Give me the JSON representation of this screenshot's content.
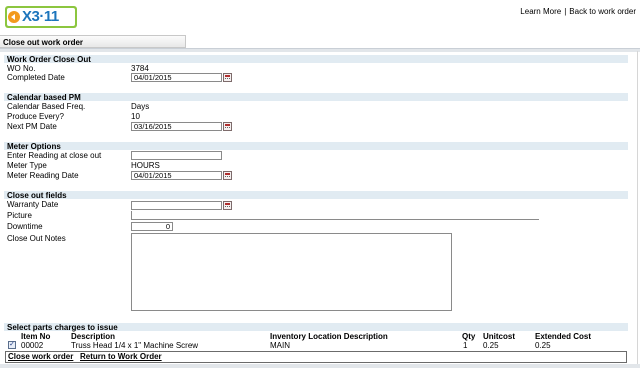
{
  "header": {
    "logo_text": "X3·11",
    "learn_more": "Learn More",
    "separator": "|",
    "back_link": "Back to work order"
  },
  "page_title": "Close out work order",
  "sections": {
    "close_out": {
      "title": "Work Order Close Out",
      "wo_label": "WO No.",
      "wo_value": "3784",
      "completed_label": "Completed Date",
      "completed_value": "04/01/2015"
    },
    "calendar_pm": {
      "title": "Calendar based PM",
      "freq_label": "Calendar Based Freq.",
      "freq_value": "Days",
      "produce_label": "Produce Every?",
      "produce_value": "10",
      "next_label": "Next PM Date",
      "next_value": "03/16/2015"
    },
    "meter": {
      "title": "Meter Options",
      "reading_label": "Enter Reading at close out",
      "reading_value": "",
      "type_label": "Meter Type",
      "type_value": "HOURS",
      "date_label": "Meter Reading Date",
      "date_value": "04/01/2015"
    },
    "fields": {
      "title": "Close out fields",
      "warranty_label": "Warranty Date",
      "warranty_value": "",
      "picture_label": "Picture",
      "picture_value": "",
      "downtime_label": "Downtime",
      "downtime_value": "0",
      "notes_label": "Close Out Notes",
      "notes_value": ""
    }
  },
  "parts": {
    "title": "Select parts charges to issue",
    "columns": {
      "item_no": "Item No",
      "description": "Description",
      "location": "Inventory Location Description",
      "qty": "Qty",
      "unitcost": "Unitcost",
      "extended": "Extended Cost"
    },
    "rows": [
      {
        "checked": true,
        "item_no": "00002",
        "description": "Truss Head 1/4 x 1\" Machine Screw",
        "location": "MAIN",
        "qty": "1",
        "unitcost": "0.25",
        "extended": "0.25"
      }
    ]
  },
  "footer": {
    "close_label": "Close work order",
    "return_label": "Return to Work Order"
  },
  "colors": {
    "section_bg": "#e1ebf2",
    "logo_orange": "#f29a1d",
    "logo_green": "#8cc63f",
    "logo_blue": "#1c75bc"
  },
  "icons": {
    "calendar": "calendar-icon",
    "checkbox": "checkbox-checked-icon"
  }
}
